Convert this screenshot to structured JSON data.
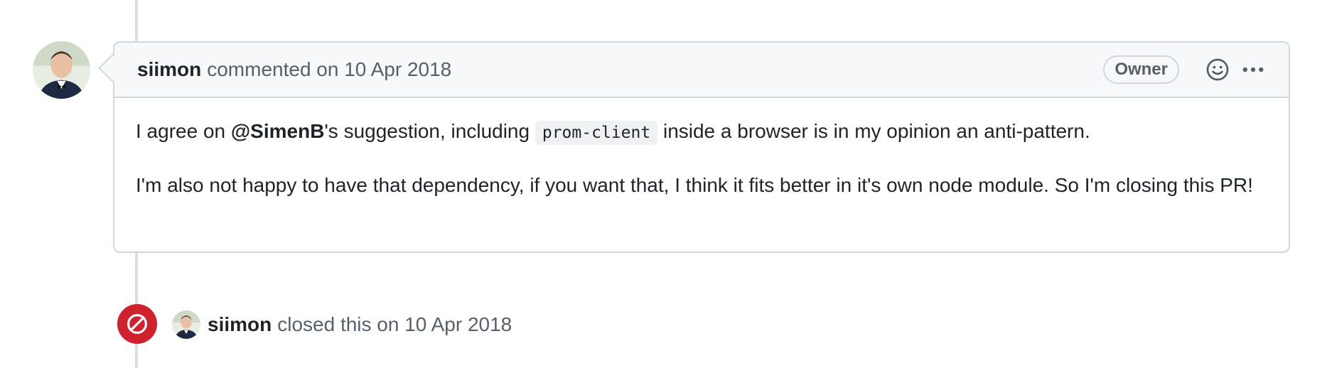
{
  "comment": {
    "author": "siimon",
    "action": "commented on 10 Apr 2018",
    "role_badge": "Owner",
    "body": {
      "p1_before": "I agree on ",
      "p1_mention": "@SimenB",
      "p1_middle": "'s suggestion, including ",
      "p1_code": "prom-client",
      "p1_after": " inside a browser is in my opinion an anti-pattern.",
      "p2": "I'm also not happy to have that dependency, if you want that, I think it fits better in it's own node module. So I'm closing this PR!"
    },
    "icons": {
      "reaction": "smiley-icon",
      "more": "kebab-horizontal-icon"
    }
  },
  "event": {
    "author": "siimon",
    "action": "closed this on 10 Apr 2018",
    "icon": "circle-slash-icon",
    "icon_color": "#cf222e"
  },
  "colors": {
    "border": "#d0d7de",
    "header_bg": "#f6f8fa",
    "muted_text": "#57606a",
    "closed_red": "#cf222e"
  }
}
